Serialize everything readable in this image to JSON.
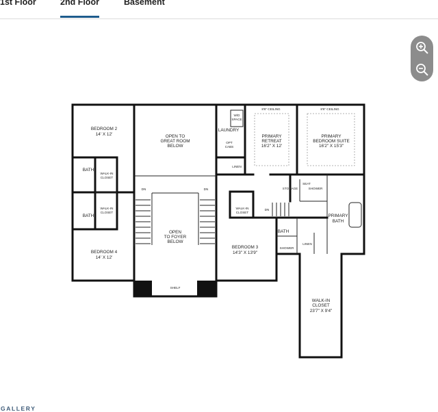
{
  "tabs": [
    {
      "label": "1st Floor",
      "active": false
    },
    {
      "label": "2nd Floor",
      "active": true
    },
    {
      "label": "Basement",
      "active": false
    }
  ],
  "zoom": {
    "zoom_in_icon": "zoom-in-icon",
    "zoom_out_icon": "zoom-out-icon"
  },
  "gallery_label": "GALLERY",
  "accent_color": "#1d5b8c",
  "rooms": {
    "bedroom2": {
      "name": "BEDROOM 2",
      "size": "14' X 12'"
    },
    "open_great_room": {
      "l1": "OPEN TO",
      "l2": "GREAT ROOM",
      "l3": "BELOW"
    },
    "laundry": "LAUNDRY",
    "wd_space": {
      "l1": "W/D",
      "l2": "SPACE"
    },
    "opt_cabs": {
      "l1": "OPT",
      "l2": "CABS"
    },
    "linen": "LINEN",
    "ceiling_retreat": "8'6\" CEILING",
    "ceiling_suite": "8'6\" CEILING",
    "primary_retreat": {
      "l1": "PRIMARY",
      "l2": "RETREAT",
      "size": "16'2\" X 12'"
    },
    "primary_suite": {
      "l1": "PRIMARY",
      "l2": "BEDROOM SUITE",
      "size": "16'2\" X 15'3\""
    },
    "bath_a": "BATH",
    "walkin_closet_a": {
      "l1": "WALK-IN",
      "l2": "CLOSET"
    },
    "bath_b": "BATH",
    "walkin_closet_b": {
      "l1": "WALK-IN",
      "l2": "CLOSET"
    },
    "dn_left": "DN",
    "dn_right": "DN",
    "open_foyer": {
      "l1": "OPEN",
      "l2": "TO FOYER",
      "l3": "BELOW"
    },
    "bedroom4": {
      "name": "BEDROOM 4",
      "size": "14' X 12'"
    },
    "shelf": "SHELF",
    "storage": "STORAGE",
    "seat": "SEAT",
    "shower_primary": "SHOWER",
    "walkin_closet_c": {
      "l1": "WALK-IN",
      "l2": "CLOSET"
    },
    "dn_stair": "DN",
    "primary_bath": {
      "l1": "PRIMARY",
      "l2": "BATH"
    },
    "bath_c": "BATH",
    "shower_c": "SHOWER",
    "linen_b": "LINEN",
    "bedroom3": {
      "name": "BEDROOM 3",
      "size": "14'3\" X 13'9\""
    },
    "walkin_closet_big": {
      "l1": "WALK-IN",
      "l2": "CLOSET",
      "size": "23'7\" X 9'4\""
    }
  }
}
